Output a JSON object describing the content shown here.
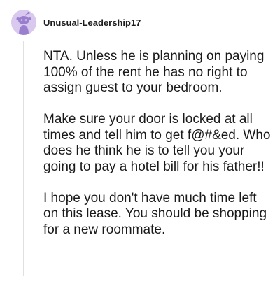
{
  "comment": {
    "username": "Unusual-Leadership17",
    "avatar_icon": "snoo-avatar-icon",
    "paragraphs": [
      "NTA. Unless he is planning on paying 100% of the rent he has no right to assign guest to your bedroom.",
      "Make sure your door is locked at all times and tell him to get f@#&ed. Who does he think he is to tell you your going to pay a hotel bill for his father!!",
      "I hope you don't have much time left on this lease. You should be shopping for a new roommate."
    ]
  },
  "colors": {
    "avatar_background": "#d9c9ef",
    "avatar_figure": "#9b7fcf",
    "thread_line": "#e0e0e0",
    "text": "#1a1a1b"
  }
}
